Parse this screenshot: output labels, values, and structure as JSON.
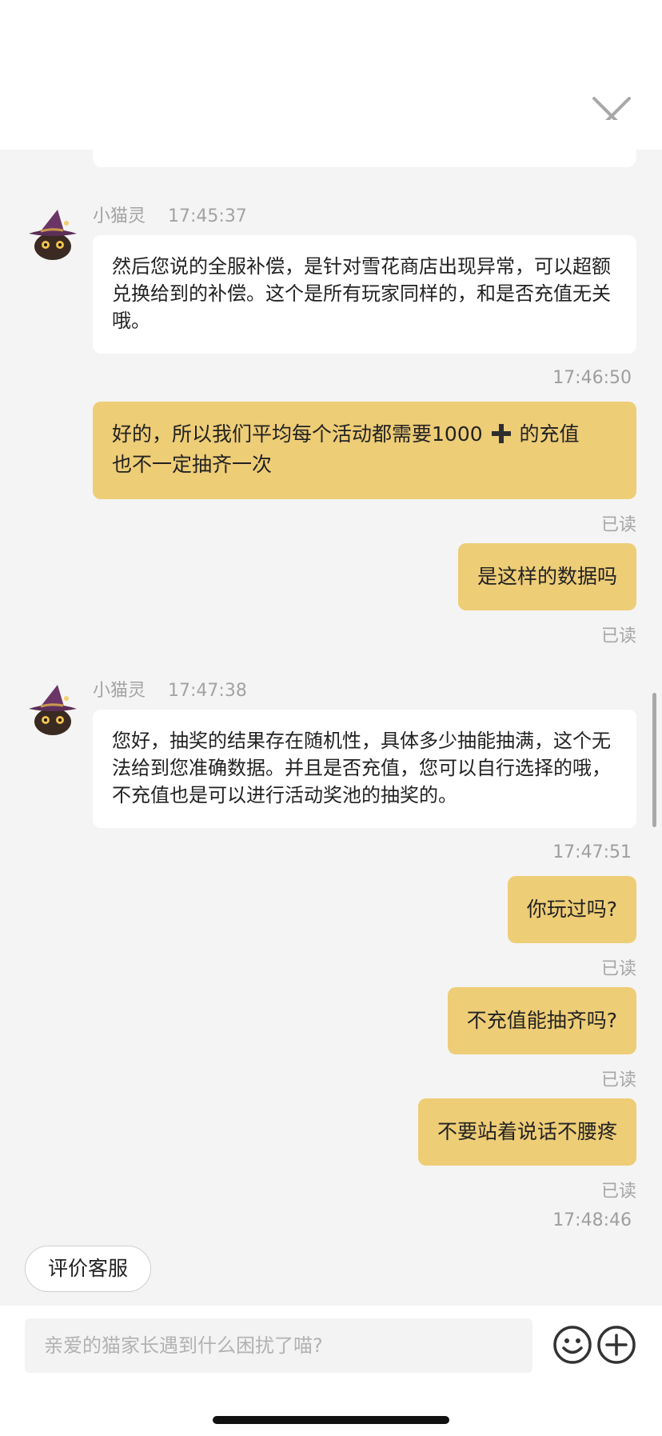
{
  "header": {
    "close_icon": "close-icon"
  },
  "messages": {
    "m1": {
      "sender": "小猫灵",
      "time": "17:45:37",
      "text": "然后您说的全服补偿，是针对雪花商店出现异常，可以超额兑换给到的补偿。这个是所有玩家同样的，和是否充值无关哦。"
    },
    "ts1": "17:46:50",
    "m2": {
      "text_before": "好的，所以我们平均每个活动都需要1000",
      "text_after": "的充值",
      "line2": "也不一定抽齐一次",
      "read": "已读"
    },
    "m3": {
      "text": "是这样的数据吗",
      "read": "已读"
    },
    "m4": {
      "sender": "小猫灵",
      "time": "17:47:38",
      "text": "您好，抽奖的结果存在随机性，具体多少抽能抽满，这个无法给到您准确数据。并且是否充值，您可以自行选择的哦，不充值也是可以进行活动奖池的抽奖的。"
    },
    "ts2": "17:47:51",
    "m5": {
      "text": "你玩过吗?",
      "read": "已读"
    },
    "m6": {
      "text": "不充值能抽齐吗?",
      "read": "已读"
    },
    "m7": {
      "text": "不要站着说话不腰疼",
      "read": "已读"
    },
    "ts3": "17:48:46"
  },
  "rate_button": {
    "label": "评价客服"
  },
  "input": {
    "placeholder": "亲爱的猫家长遇到什么困扰了喵?"
  },
  "colors": {
    "user_bubble": "#eecd77",
    "agent_bubble": "#ffffff",
    "background": "#f4f4f4"
  }
}
